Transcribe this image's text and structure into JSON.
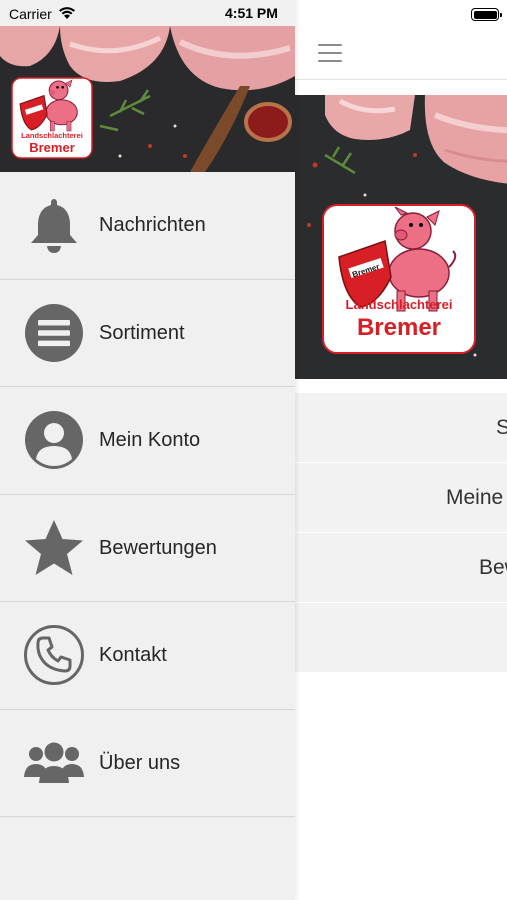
{
  "status_bar": {
    "carrier": "Carrier",
    "time": "4:51 PM",
    "wifi_icon": "wifi-icon",
    "battery_icon": "battery-icon"
  },
  "brand": {
    "line1": "Landschlachterei",
    "line2": "Bremer",
    "shield_text": "Bremer",
    "colors": {
      "red": "#d81f26",
      "pink": "#ec6f86",
      "dark": "#2b2c2e"
    }
  },
  "drawer": {
    "items": [
      {
        "label": "Nachrichten",
        "icon": "bell-icon"
      },
      {
        "label": "Sortiment",
        "icon": "list-circle-icon"
      },
      {
        "label": "Mein Konto",
        "icon": "user-circle-icon"
      },
      {
        "label": "Bewertungen",
        "icon": "star-icon"
      },
      {
        "label": "Kontakt",
        "icon": "phone-icon"
      },
      {
        "label": "Über uns",
        "icon": "group-icon"
      }
    ]
  },
  "main": {
    "menu_icon": "hamburger-icon",
    "visible_rows": [
      {
        "label": "S"
      },
      {
        "label": "Meine"
      },
      {
        "label": "Bew"
      },
      {
        "label": ""
      }
    ]
  },
  "colors": {
    "icon_gray": "#666666",
    "drawer_bg": "#f0f0f0",
    "row_bg": "#f2f2f2",
    "divider": "#d6d6d6"
  }
}
